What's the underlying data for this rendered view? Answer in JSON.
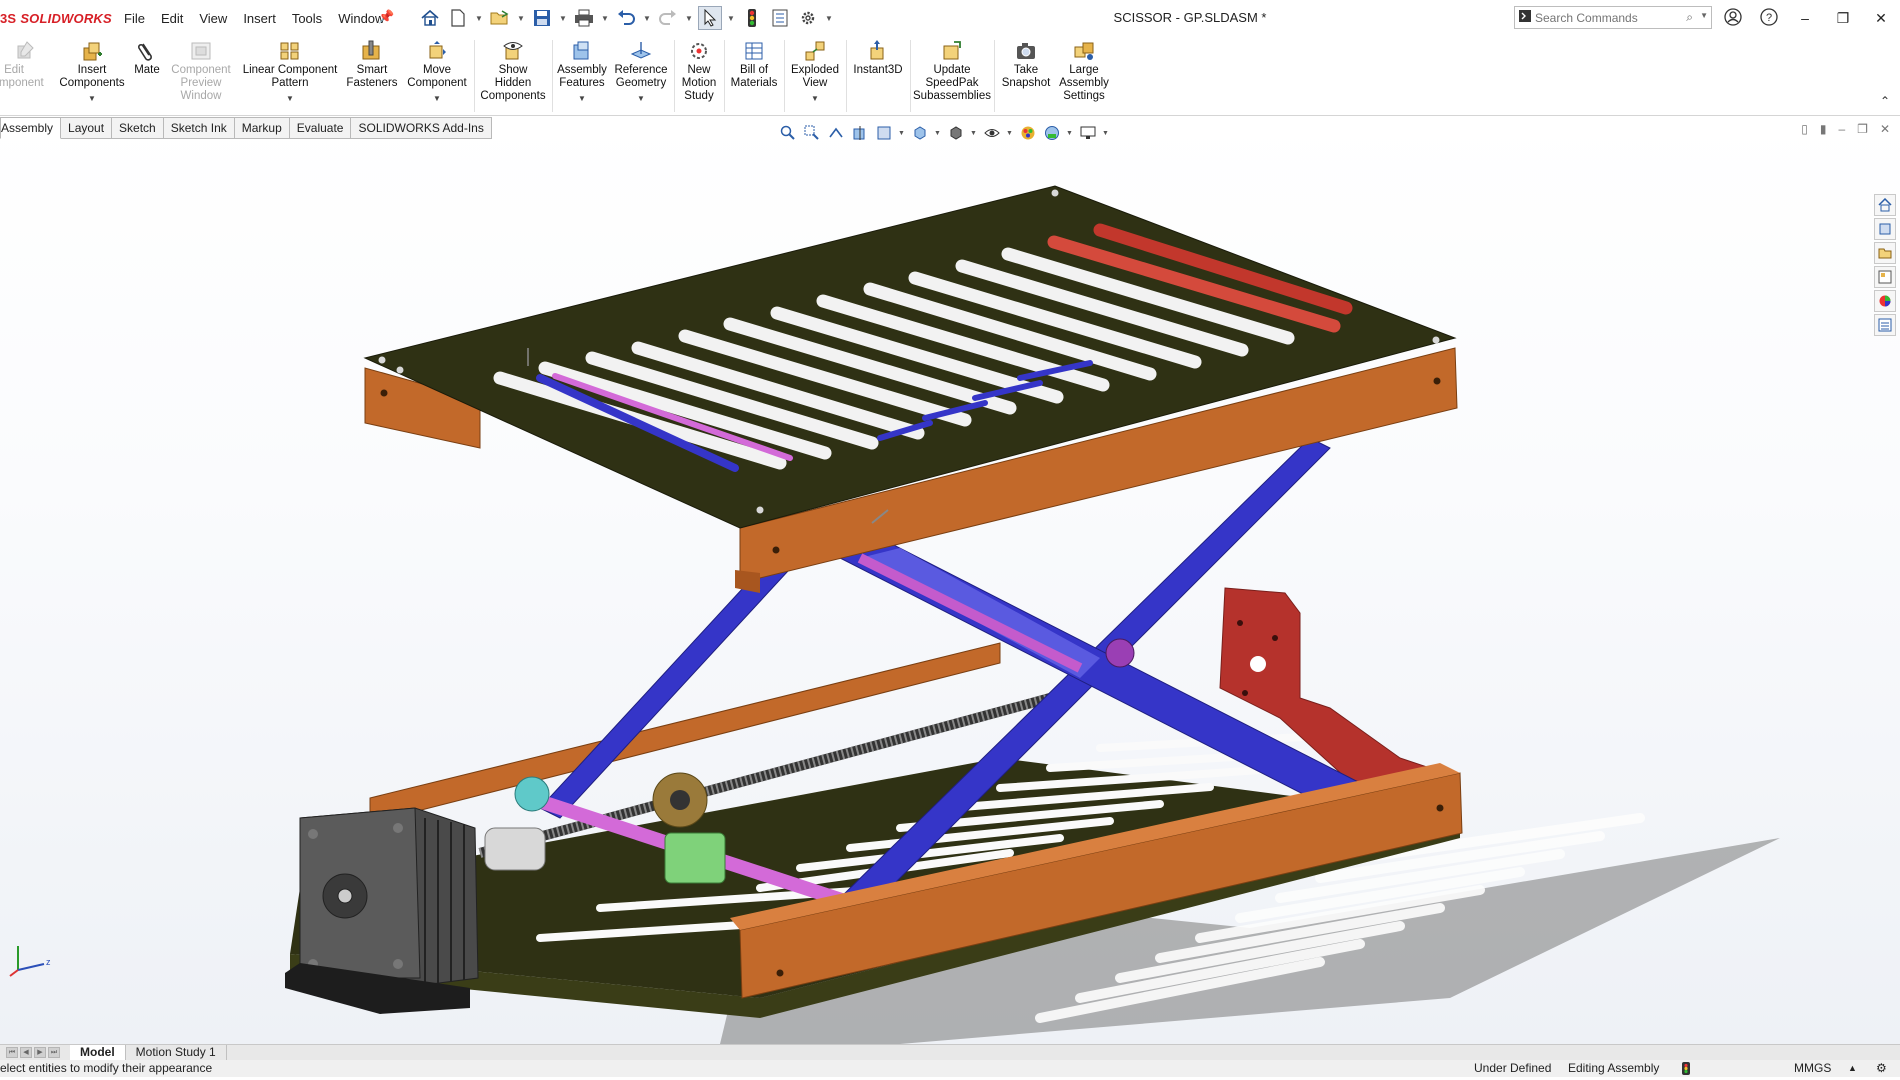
{
  "titlebar": {
    "brand": "SOLIDWORKS",
    "brand_prefix": "3S",
    "menu": [
      "File",
      "Edit",
      "View",
      "Insert",
      "Tools",
      "Window"
    ],
    "document_title": "SCISSOR - GP.SLDASM *",
    "search_placeholder": "Search Commands"
  },
  "ribbon": {
    "buttons": [
      {
        "label": "Edit\nComponent",
        "disabled": true
      },
      {
        "label": "Insert\nComponents",
        "disabled": false
      },
      {
        "label": "Mate",
        "disabled": false
      },
      {
        "label": "Component\nPreview\nWindow",
        "disabled": true
      },
      {
        "label": "Linear Component\nPattern",
        "disabled": false
      },
      {
        "label": "Smart\nFasteners",
        "disabled": false
      },
      {
        "label": "Move\nComponent",
        "disabled": false
      },
      {
        "label": "Show\nHidden\nComponents",
        "disabled": false
      },
      {
        "label": "Assembly\nFeatures",
        "disabled": false
      },
      {
        "label": "Reference\nGeometry",
        "disabled": false
      },
      {
        "label": "New\nMotion\nStudy",
        "disabled": false
      },
      {
        "label": "Bill of\nMaterials",
        "disabled": false
      },
      {
        "label": "Exploded\nView",
        "disabled": false
      },
      {
        "label": "Instant3D",
        "disabled": false
      },
      {
        "label": "Update\nSpeedPak\nSubassemblies",
        "disabled": false
      },
      {
        "label": "Take\nSnapshot",
        "disabled": false
      },
      {
        "label": "Large\nAssembly\nSettings",
        "disabled": false
      }
    ]
  },
  "tabs": [
    "Assembly",
    "Layout",
    "Sketch",
    "Sketch Ink",
    "Markup",
    "Evaluate",
    "SOLIDWORKS Add-Ins"
  ],
  "bottom_tabs": [
    "Model",
    "Motion Study 1"
  ],
  "status": {
    "message": "Select entities to modify their appearance",
    "definition": "Under Defined",
    "mode": "Editing Assembly",
    "units": "MMGS"
  },
  "colors": {
    "plate": "#2f3114",
    "frame": "#c2692a",
    "arm": "#3535c8",
    "rod": "#d36ad8",
    "bracket": "#b5322c",
    "nut": "#7fd27a",
    "motor": "#4a4a4a"
  }
}
